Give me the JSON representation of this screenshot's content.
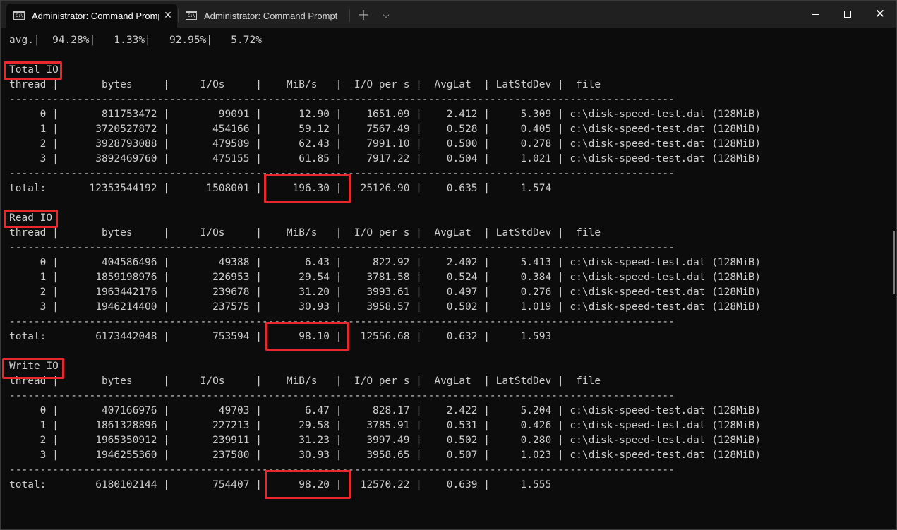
{
  "tabs": [
    {
      "title": "Administrator: Command Prompt",
      "icon": "command-prompt-icon",
      "active": true
    },
    {
      "title": "Administrator: Command Prompt",
      "icon": "command-prompt-icon",
      "active": false
    }
  ],
  "tab_icon_glyph": "C:\\",
  "tab_close_glyph": "✕",
  "new_tab_glyph": "+",
  "dropdown_glyph": "⌵",
  "window_close_glyph": "✕",
  "terminal": {
    "lines": [
      {
        "text": "avg.|  94.28%|   1.33%|   92.95%|   5.72%"
      },
      {
        "text": ""
      },
      {
        "text": "Total IO",
        "section": "total"
      },
      {
        "text": "thread |       bytes     |     I/Os     |    MiB/s   |  I/O per s |  AvgLat  | LatStdDev |  file"
      },
      {
        "text": "------------------------------------------------------------------------------------------------------------"
      },
      {
        "text": "     0 |       811753472 |        99091 |      12.90 |    1651.09 |    2.412 |     5.309 | c:\\disk-speed-test.dat (128MiB)"
      },
      {
        "text": "     1 |      3720527872 |       454166 |      59.12 |    7567.49 |    0.528 |     0.405 | c:\\disk-speed-test.dat (128MiB)"
      },
      {
        "text": "     2 |      3928793088 |       479589 |      62.43 |    7991.10 |    0.500 |     0.278 | c:\\disk-speed-test.dat (128MiB)"
      },
      {
        "text": "     3 |      3892469760 |       475155 |      61.85 |    7917.22 |    0.504 |     1.021 | c:\\disk-speed-test.dat (128MiB)"
      },
      {
        "text": "------------------------------------------------------------------------------------------------------------"
      },
      {
        "text": "total:       12353544192 |      1508001 |     196.30 |   25126.90 |    0.635 |     1.574"
      },
      {
        "text": ""
      },
      {
        "text": "Read IO",
        "section": "read"
      },
      {
        "text": "thread |       bytes     |     I/Os     |    MiB/s   |  I/O per s |  AvgLat  | LatStdDev |  file"
      },
      {
        "text": "------------------------------------------------------------------------------------------------------------"
      },
      {
        "text": "     0 |       404586496 |        49388 |       6.43 |     822.92 |    2.402 |     5.413 | c:\\disk-speed-test.dat (128MiB)"
      },
      {
        "text": "     1 |      1859198976 |       226953 |      29.54 |    3781.58 |    0.524 |     0.384 | c:\\disk-speed-test.dat (128MiB)"
      },
      {
        "text": "     2 |      1963442176 |       239678 |      31.20 |    3993.61 |    0.497 |     0.276 | c:\\disk-speed-test.dat (128MiB)"
      },
      {
        "text": "     3 |      1946214400 |       237575 |      30.93 |    3958.57 |    0.502 |     1.019 | c:\\disk-speed-test.dat (128MiB)"
      },
      {
        "text": "------------------------------------------------------------------------------------------------------------"
      },
      {
        "text": "total:        6173442048 |       753594 |      98.10 |   12556.68 |    0.632 |     1.593"
      },
      {
        "text": ""
      },
      {
        "text": "Write IO",
        "section": "write"
      },
      {
        "text": "thread |       bytes     |     I/Os     |    MiB/s   |  I/O per s |  AvgLat  | LatStdDev |  file"
      },
      {
        "text": "------------------------------------------------------------------------------------------------------------"
      },
      {
        "text": "     0 |       407166976 |        49703 |       6.47 |     828.17 |    2.422 |     5.204 | c:\\disk-speed-test.dat (128MiB)"
      },
      {
        "text": "     1 |      1861328896 |       227213 |      29.58 |    3785.91 |    0.531 |     0.426 | c:\\disk-speed-test.dat (128MiB)"
      },
      {
        "text": "     2 |      1965350912 |       239911 |      31.23 |    3997.49 |    0.502 |     0.280 | c:\\disk-speed-test.dat (128MiB)"
      },
      {
        "text": "     3 |      1946255360 |       237580 |      30.93 |    3958.65 |    0.507 |     1.023 | c:\\disk-speed-test.dat (128MiB)"
      },
      {
        "text": "------------------------------------------------------------------------------------------------------------"
      },
      {
        "text": "total:        6180102144 |       754407 |      98.20 |   12570.22 |    0.639 |     1.555"
      }
    ]
  },
  "annotation_color": "#e8282d"
}
